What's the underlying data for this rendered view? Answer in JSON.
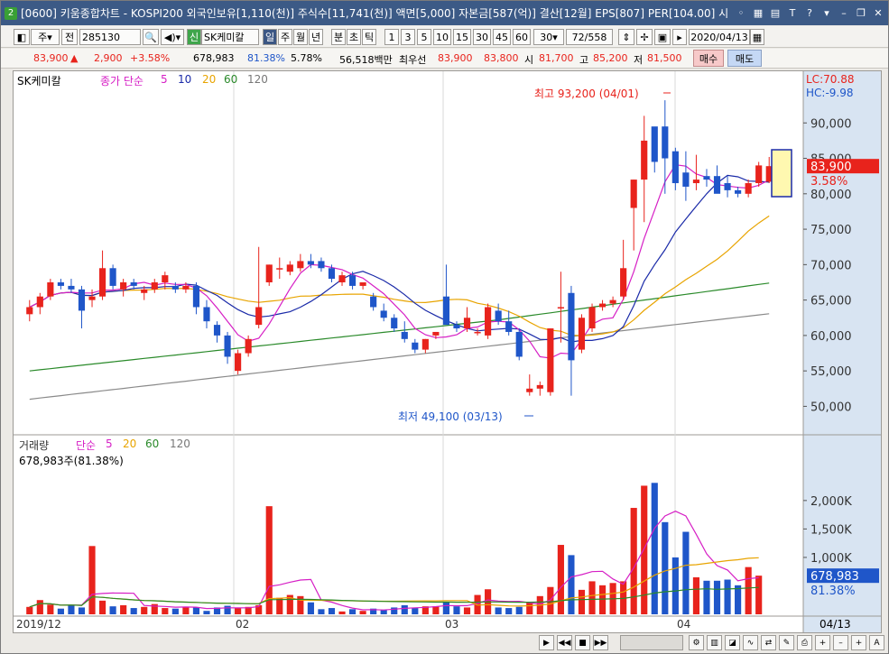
{
  "title": {
    "text": "[0600] 키움종합차트 - KOSPI200 외국인보유[1,110(천)] 주식수[11,741(천)] 액면[5,000] 자본금[587(억)] 결산[12월] EPS[807] PER[104.00] 시",
    "app_icon": "2"
  },
  "toolbar": {
    "period": "주",
    "prev": "전",
    "code": "285130",
    "market_badge": "신",
    "stock_name": "SK케미칼",
    "intervals": [
      "일",
      "주",
      "월",
      "년",
      "분",
      "초",
      "틱"
    ],
    "minute_options": [
      "1",
      "3",
      "5",
      "10",
      "15",
      "30",
      "45",
      "60"
    ],
    "custom_minute": "30",
    "count": "72",
    "total": "/558",
    "date": "2020/04/13"
  },
  "info": {
    "price": "83,900",
    "arrow": "▲",
    "change": "2,900",
    "rate": "+3.58%",
    "volume": "678,983",
    "vol_ratio": "81.38%",
    "turnover": "5.78%",
    "amount": "56,518백만",
    "best_label": "최우선",
    "ask": "83,900",
    "bid": "83,800",
    "open_label": "시",
    "open": "81,700",
    "high_label": "고",
    "high": "85,200",
    "low_label": "저",
    "low": "81,500",
    "buy": "매수",
    "sell": "매도"
  },
  "legend": {
    "name": "SK케미칼",
    "ma_label": "종가 단순",
    "periods": [
      "5",
      "10",
      "20",
      "60",
      "120"
    ],
    "lc": "LC:70.88",
    "hc": "HC:-9.98"
  },
  "annotations": {
    "high": "최고 93,200 (04/01)",
    "low": "최저 49,100 (03/13)"
  },
  "price_axis": {
    "ticks": [
      "90,000",
      "85,000",
      "80,000",
      "75,000",
      "70,000",
      "65,000",
      "60,000",
      "55,000",
      "50,000"
    ],
    "current": "83,900",
    "current_rate": "3.58%"
  },
  "volume_panel": {
    "label": "거래량",
    "ma_label": "단순",
    "periods": [
      "5",
      "20",
      "60",
      "120"
    ],
    "info": "678,983주(81.38%)",
    "ticks": [
      "2,000K",
      "1,500K",
      "1,000K"
    ],
    "current": "678,983",
    "current_rate": "81.38%"
  },
  "date_axis": {
    "labels": [
      "2019/12",
      "02",
      "03",
      "04"
    ],
    "last": "04/13"
  },
  "colors": {
    "up": "#e8231c",
    "down": "#1f56c9",
    "ma5": "#d61fc5",
    "ma10": "#1a2aa8",
    "ma20": "#e8a400",
    "ma60": "#2a8a2a",
    "ma120": "#8a8a8a"
  },
  "chart_data": {
    "type": "candlestick",
    "units": "KRW",
    "candles": [
      {
        "o": 63000,
        "h": 65000,
        "l": 62000,
        "c": 64000
      },
      {
        "o": 64000,
        "h": 66000,
        "l": 63000,
        "c": 65500
      },
      {
        "o": 65500,
        "h": 68000,
        "l": 65000,
        "c": 67500
      },
      {
        "o": 67500,
        "h": 68000,
        "l": 66500,
        "c": 67000
      },
      {
        "o": 67000,
        "h": 68000,
        "l": 66000,
        "c": 66500
      },
      {
        "o": 66500,
        "h": 67000,
        "l": 61000,
        "c": 63500
      },
      {
        "o": 65000,
        "h": 66500,
        "l": 64000,
        "c": 65500
      },
      {
        "o": 65500,
        "h": 72000,
        "l": 65000,
        "c": 69500
      },
      {
        "o": 69500,
        "h": 70000,
        "l": 66500,
        "c": 67000
      },
      {
        "o": 66500,
        "h": 68000,
        "l": 65500,
        "c": 67500
      },
      {
        "o": 67500,
        "h": 68000,
        "l": 66500,
        "c": 67000
      },
      {
        "o": 66000,
        "h": 67000,
        "l": 65000,
        "c": 66500
      },
      {
        "o": 66500,
        "h": 68000,
        "l": 66000,
        "c": 67500
      },
      {
        "o": 67500,
        "h": 69000,
        "l": 66500,
        "c": 68500
      },
      {
        "o": 67000,
        "h": 67500,
        "l": 66000,
        "c": 66500
      },
      {
        "o": 66500,
        "h": 67500,
        "l": 66000,
        "c": 67000
      },
      {
        "o": 67000,
        "h": 67500,
        "l": 63000,
        "c": 64000
      },
      {
        "o": 64000,
        "h": 65000,
        "l": 61000,
        "c": 62000
      },
      {
        "o": 61500,
        "h": 62000,
        "l": 59000,
        "c": 60000
      },
      {
        "o": 60000,
        "h": 60500,
        "l": 56000,
        "c": 57000
      },
      {
        "o": 55000,
        "h": 58000,
        "l": 54500,
        "c": 57500
      },
      {
        "o": 57500,
        "h": 60000,
        "l": 57000,
        "c": 59500
      },
      {
        "o": 61500,
        "h": 72500,
        "l": 61000,
        "c": 64000
      },
      {
        "o": 67500,
        "h": 70000,
        "l": 67000,
        "c": 70000
      },
      {
        "o": 69500,
        "h": 71000,
        "l": 68000,
        "c": 69500
      },
      {
        "o": 69000,
        "h": 70500,
        "l": 68500,
        "c": 70000
      },
      {
        "o": 69500,
        "h": 71500,
        "l": 69000,
        "c": 70500
      },
      {
        "o": 70500,
        "h": 71500,
        "l": 69500,
        "c": 70000
      },
      {
        "o": 70500,
        "h": 71000,
        "l": 69000,
        "c": 69500
      },
      {
        "o": 69500,
        "h": 70000,
        "l": 67500,
        "c": 68000
      },
      {
        "o": 67500,
        "h": 69000,
        "l": 67000,
        "c": 68500
      },
      {
        "o": 68500,
        "h": 69000,
        "l": 66500,
        "c": 67000
      },
      {
        "o": 67000,
        "h": 67500,
        "l": 66500,
        "c": 67500
      },
      {
        "o": 65500,
        "h": 66000,
        "l": 63500,
        "c": 64000
      },
      {
        "o": 63500,
        "h": 64500,
        "l": 62000,
        "c": 62500
      },
      {
        "o": 62500,
        "h": 63000,
        "l": 60500,
        "c": 61000
      },
      {
        "o": 60500,
        "h": 62000,
        "l": 59000,
        "c": 59500
      },
      {
        "o": 59000,
        "h": 59500,
        "l": 57500,
        "c": 58000
      },
      {
        "o": 58000,
        "h": 59500,
        "l": 57500,
        "c": 59500
      },
      {
        "o": 60000,
        "h": 60500,
        "l": 59500,
        "c": 60500
      },
      {
        "o": 65500,
        "h": 70000,
        "l": 64000,
        "c": 61500
      },
      {
        "o": 61500,
        "h": 62000,
        "l": 60500,
        "c": 61000
      },
      {
        "o": 61000,
        "h": 64000,
        "l": 60500,
        "c": 62500
      },
      {
        "o": 60500,
        "h": 61000,
        "l": 60000,
        "c": 60500
      },
      {
        "o": 60000,
        "h": 64500,
        "l": 59500,
        "c": 64000
      },
      {
        "o": 63500,
        "h": 64500,
        "l": 61500,
        "c": 62000
      },
      {
        "o": 62000,
        "h": 63500,
        "l": 60000,
        "c": 60500
      },
      {
        "o": 60500,
        "h": 61000,
        "l": 56500,
        "c": 57000
      },
      {
        "o": 52000,
        "h": 54500,
        "l": 51500,
        "c": 52500
      },
      {
        "o": 52500,
        "h": 53500,
        "l": 51500,
        "c": 53000
      },
      {
        "o": 52000,
        "h": 61000,
        "l": 51500,
        "c": 61000
      },
      {
        "o": 64000,
        "h": 69000,
        "l": 59000,
        "c": 64000
      },
      {
        "o": 66000,
        "h": 67000,
        "l": 51500,
        "c": 56500
      },
      {
        "o": 58000,
        "h": 63000,
        "l": 57500,
        "c": 62500
      },
      {
        "o": 61000,
        "h": 64500,
        "l": 60500,
        "c": 64000
      },
      {
        "o": 64000,
        "h": 65000,
        "l": 63500,
        "c": 64500
      },
      {
        "o": 64500,
        "h": 65500,
        "l": 64000,
        "c": 65000
      },
      {
        "o": 65500,
        "h": 73500,
        "l": 65000,
        "c": 69500
      },
      {
        "o": 78000,
        "h": 82000,
        "l": 72000,
        "c": 82000
      },
      {
        "o": 82000,
        "h": 91000,
        "l": 76000,
        "c": 87500
      },
      {
        "o": 89500,
        "h": 89000,
        "l": 83000,
        "c": 84500
      },
      {
        "o": 89500,
        "h": 93200,
        "l": 80000,
        "c": 85000
      },
      {
        "o": 86000,
        "h": 86500,
        "l": 80500,
        "c": 81500
      },
      {
        "o": 83000,
        "h": 86000,
        "l": 79000,
        "c": 81000
      },
      {
        "o": 81500,
        "h": 85500,
        "l": 80500,
        "c": 82000
      },
      {
        "o": 82500,
        "h": 83500,
        "l": 81000,
        "c": 82000
      },
      {
        "o": 82500,
        "h": 84000,
        "l": 81500,
        "c": 80000
      },
      {
        "o": 81500,
        "h": 82500,
        "l": 79500,
        "c": 80500
      },
      {
        "o": 80500,
        "h": 81000,
        "l": 79500,
        "c": 80000
      },
      {
        "o": 80000,
        "h": 82000,
        "l": 79500,
        "c": 81500
      },
      {
        "o": 81500,
        "h": 84500,
        "l": 81000,
        "c": 84000
      },
      {
        "o": 81700,
        "h": 85200,
        "l": 81500,
        "c": 83900
      }
    ],
    "volume": [
      130000,
      250000,
      170000,
      100000,
      170000,
      120000,
      1200000,
      240000,
      140000,
      160000,
      110000,
      130000,
      180000,
      110000,
      100000,
      120000,
      120000,
      60000,
      120000,
      150000,
      110000,
      130000,
      160000,
      1900000,
      290000,
      340000,
      320000,
      210000,
      90000,
      110000,
      50000,
      90000,
      60000,
      100000,
      80000,
      120000,
      160000,
      110000,
      140000,
      140000,
      220000,
      140000,
      120000,
      340000,
      440000,
      120000,
      110000,
      130000,
      220000,
      320000,
      480000,
      1220000,
      1040000,
      430000,
      580000,
      510000,
      550000,
      580000,
      1870000,
      2260000,
      2310000,
      1620000,
      1000000,
      1450000,
      650000,
      590000,
      590000,
      610000,
      510000,
      830000,
      678983
    ],
    "title": "SK케미칼",
    "ylim": [
      47000,
      95000
    ]
  }
}
